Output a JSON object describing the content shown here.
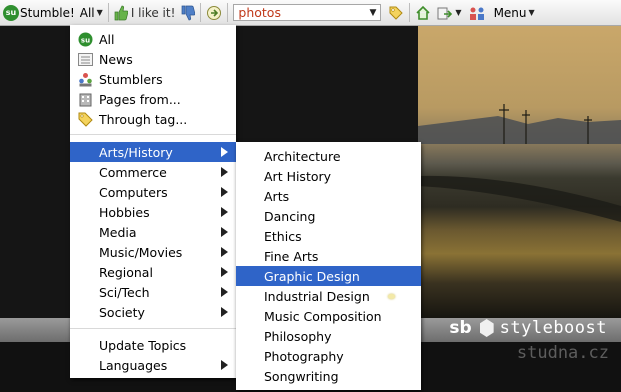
{
  "toolbar": {
    "stumble_label": "Stumble!",
    "all_label": "All",
    "like_label": "I like it!",
    "search_value": "photos",
    "menu_label": "Menu"
  },
  "main_menu": {
    "top_items": [
      {
        "label": "All",
        "icon": "stumbleupon-icon"
      },
      {
        "label": "News",
        "icon": "newspaper-icon"
      },
      {
        "label": "Stumblers",
        "icon": "people-icon"
      },
      {
        "label": "Pages from...",
        "icon": "building-icon"
      },
      {
        "label": "Through tag...",
        "icon": "tag-icon"
      }
    ],
    "categories": [
      {
        "label": "Arts/History",
        "selected": true
      },
      {
        "label": "Commerce"
      },
      {
        "label": "Computers"
      },
      {
        "label": "Hobbies"
      },
      {
        "label": "Media"
      },
      {
        "label": "Music/Movies"
      },
      {
        "label": "Regional"
      },
      {
        "label": "Sci/Tech"
      },
      {
        "label": "Society"
      }
    ],
    "bottom_items": [
      {
        "label": "Update Topics",
        "has_submenu": false
      },
      {
        "label": "Languages",
        "has_submenu": true
      }
    ]
  },
  "sub_menu": {
    "items": [
      {
        "label": "Architecture"
      },
      {
        "label": "Art History"
      },
      {
        "label": "Arts"
      },
      {
        "label": "Dancing"
      },
      {
        "label": "Ethics"
      },
      {
        "label": "Fine Arts"
      },
      {
        "label": "Graphic Design",
        "selected": true
      },
      {
        "label": "Industrial Design"
      },
      {
        "label": "Music Composition"
      },
      {
        "label": "Philosophy"
      },
      {
        "label": "Photography"
      },
      {
        "label": "Songwriting"
      }
    ]
  },
  "footer": {
    "logo_mark": "sb",
    "logo_name": "styleboost",
    "credit": "studna.cz"
  },
  "colors": {
    "highlight": "#2f64c8",
    "search_text": "#c0391a"
  }
}
